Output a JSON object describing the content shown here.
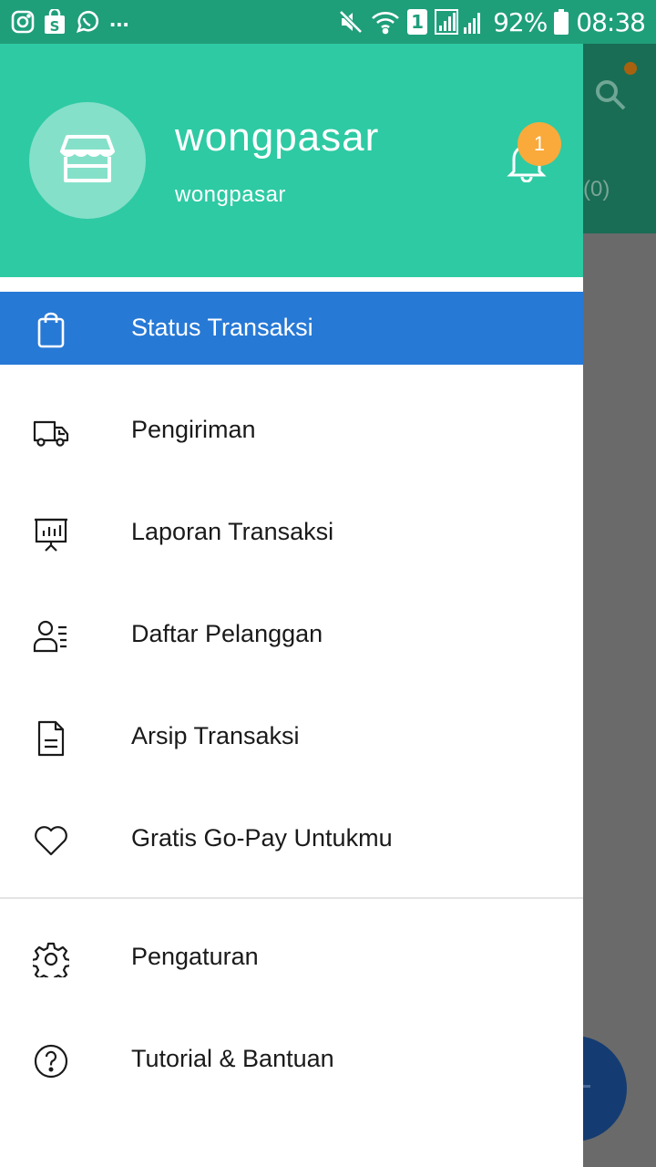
{
  "status_bar": {
    "dots": "...",
    "battery": "92%",
    "time": "08:38",
    "sim_slot": "1",
    "notification_icons": [
      "instagram-icon",
      "shop-bag-icon",
      "whatsapp-icon"
    ],
    "system_icons": [
      "mute-icon",
      "wifi-icon",
      "sim-icon",
      "signal-icon",
      "battery-icon"
    ]
  },
  "background": {
    "count_label": "(0)"
  },
  "drawer": {
    "header": {
      "shop_name": "wongpasar",
      "username": "wongpasar",
      "notification_count": "1",
      "background_color": "#2ecaa3",
      "badge_color": "#f9aa3b"
    },
    "menu": [
      {
        "label": "Status Transaksi",
        "icon": "shopping-bag-icon",
        "active": true
      },
      {
        "label": "Pengiriman",
        "icon": "delivery-truck-icon",
        "active": false
      },
      {
        "label": "Laporan Transaksi",
        "icon": "report-chart-icon",
        "active": false
      },
      {
        "label": "Daftar Pelanggan",
        "icon": "customer-list-icon",
        "active": false
      },
      {
        "label": "Arsip Transaksi",
        "icon": "document-icon",
        "active": false
      },
      {
        "label": "Gratis Go-Pay Untukmu",
        "icon": "heart-icon",
        "active": false
      }
    ],
    "secondary_menu": [
      {
        "label": "Pengaturan",
        "icon": "gear-icon"
      },
      {
        "label": "Tutorial & Bantuan",
        "icon": "help-icon"
      }
    ],
    "active_color": "#2779d6"
  }
}
